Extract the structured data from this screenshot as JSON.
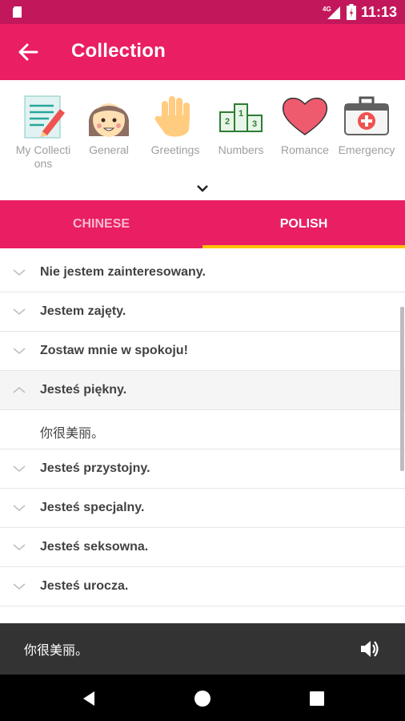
{
  "status_bar": {
    "time": "11:13",
    "network": "4G"
  },
  "app_bar": {
    "title": "Collection"
  },
  "categories": [
    {
      "label": "My Collections",
      "icon": "notepad-pencil-icon"
    },
    {
      "label": "General",
      "icon": "girl-face-icon"
    },
    {
      "label": "Greetings",
      "icon": "waving-hand-icon"
    },
    {
      "label": "Numbers",
      "icon": "podium-icon"
    },
    {
      "label": "Romance",
      "icon": "heart-icon"
    },
    {
      "label": "Emergency",
      "icon": "first-aid-kit-icon"
    }
  ],
  "tabs": [
    {
      "label": "CHINESE",
      "active": false
    },
    {
      "label": "POLISH",
      "active": true
    }
  ],
  "phrases": [
    {
      "text": "Nie jestem zainteresowany.",
      "expanded": false
    },
    {
      "text": "Jestem zajęty.",
      "expanded": false
    },
    {
      "text": "Zostaw mnie w spokoju!",
      "expanded": false
    },
    {
      "text": "Jesteś piękny.",
      "expanded": true,
      "translation": "你很美丽。"
    },
    {
      "text": "Jesteś przystojny.",
      "expanded": false
    },
    {
      "text": "Jesteś specjalny.",
      "expanded": false
    },
    {
      "text": "Jesteś seksowna.",
      "expanded": false
    },
    {
      "text": "Jesteś urocza.",
      "expanded": false
    }
  ],
  "player": {
    "text": "你很美丽。"
  },
  "colors": {
    "primary": "#e91e63",
    "primary_dark": "#c2185b",
    "accent": "#ffc107"
  }
}
